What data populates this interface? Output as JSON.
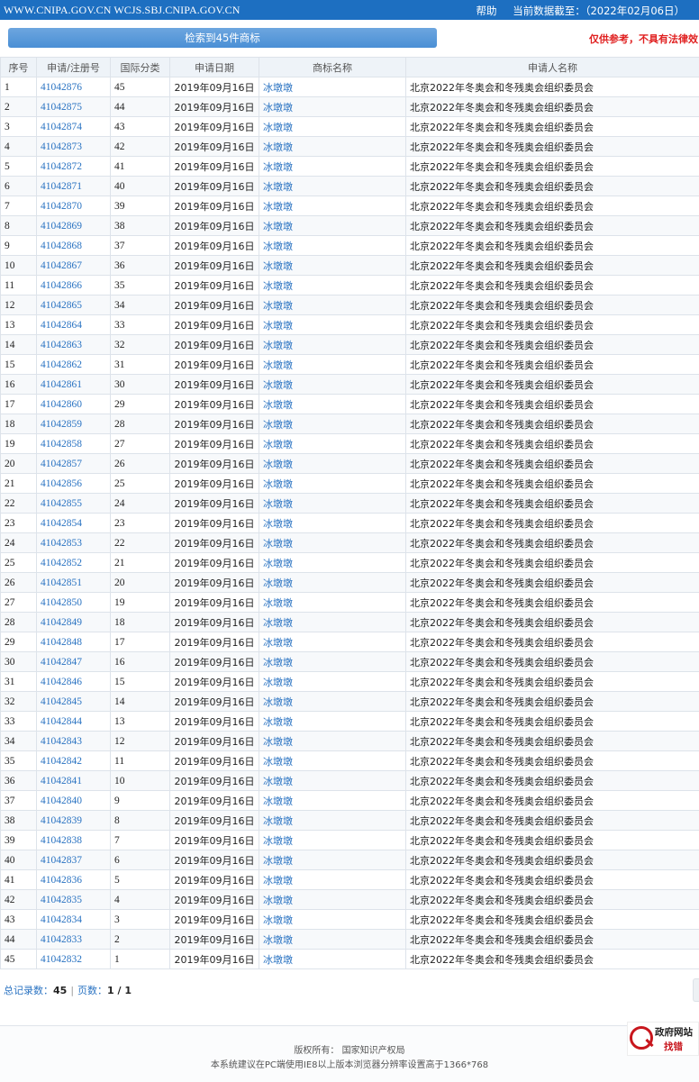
{
  "topbar": {
    "site": "WWW.CNIPA.GOV.CN WCJS.SBJ.CNIPA.GOV.CN",
    "help": "帮助",
    "data_as_of": "当前数据截至：（2022年02月06日）"
  },
  "search": {
    "result_label": "检索到45件商标",
    "disclaimer": "仅供参考，不具有法律效"
  },
  "table": {
    "headers": [
      "序号",
      "申请/注册号",
      "国际分类",
      "申请日期",
      "商标名称",
      "申请人名称"
    ],
    "rows": [
      {
        "no": "1",
        "reg": "41042876",
        "cls": "45",
        "date": "2019年09月16日",
        "mark": "冰墩墩",
        "applicant": "北京2022年冬奥会和冬残奥会组织委员会"
      },
      {
        "no": "2",
        "reg": "41042875",
        "cls": "44",
        "date": "2019年09月16日",
        "mark": "冰墩墩",
        "applicant": "北京2022年冬奥会和冬残奥会组织委员会"
      },
      {
        "no": "3",
        "reg": "41042874",
        "cls": "43",
        "date": "2019年09月16日",
        "mark": "冰墩墩",
        "applicant": "北京2022年冬奥会和冬残奥会组织委员会"
      },
      {
        "no": "4",
        "reg": "41042873",
        "cls": "42",
        "date": "2019年09月16日",
        "mark": "冰墩墩",
        "applicant": "北京2022年冬奥会和冬残奥会组织委员会"
      },
      {
        "no": "5",
        "reg": "41042872",
        "cls": "41",
        "date": "2019年09月16日",
        "mark": "冰墩墩",
        "applicant": "北京2022年冬奥会和冬残奥会组织委员会"
      },
      {
        "no": "6",
        "reg": "41042871",
        "cls": "40",
        "date": "2019年09月16日",
        "mark": "冰墩墩",
        "applicant": "北京2022年冬奥会和冬残奥会组织委员会"
      },
      {
        "no": "7",
        "reg": "41042870",
        "cls": "39",
        "date": "2019年09月16日",
        "mark": "冰墩墩",
        "applicant": "北京2022年冬奥会和冬残奥会组织委员会"
      },
      {
        "no": "8",
        "reg": "41042869",
        "cls": "38",
        "date": "2019年09月16日",
        "mark": "冰墩墩",
        "applicant": "北京2022年冬奥会和冬残奥会组织委员会"
      },
      {
        "no": "9",
        "reg": "41042868",
        "cls": "37",
        "date": "2019年09月16日",
        "mark": "冰墩墩",
        "applicant": "北京2022年冬奥会和冬残奥会组织委员会"
      },
      {
        "no": "10",
        "reg": "41042867",
        "cls": "36",
        "date": "2019年09月16日",
        "mark": "冰墩墩",
        "applicant": "北京2022年冬奥会和冬残奥会组织委员会"
      },
      {
        "no": "11",
        "reg": "41042866",
        "cls": "35",
        "date": "2019年09月16日",
        "mark": "冰墩墩",
        "applicant": "北京2022年冬奥会和冬残奥会组织委员会"
      },
      {
        "no": "12",
        "reg": "41042865",
        "cls": "34",
        "date": "2019年09月16日",
        "mark": "冰墩墩",
        "applicant": "北京2022年冬奥会和冬残奥会组织委员会"
      },
      {
        "no": "13",
        "reg": "41042864",
        "cls": "33",
        "date": "2019年09月16日",
        "mark": "冰墩墩",
        "applicant": "北京2022年冬奥会和冬残奥会组织委员会"
      },
      {
        "no": "14",
        "reg": "41042863",
        "cls": "32",
        "date": "2019年09月16日",
        "mark": "冰墩墩",
        "applicant": "北京2022年冬奥会和冬残奥会组织委员会"
      },
      {
        "no": "15",
        "reg": "41042862",
        "cls": "31",
        "date": "2019年09月16日",
        "mark": "冰墩墩",
        "applicant": "北京2022年冬奥会和冬残奥会组织委员会"
      },
      {
        "no": "16",
        "reg": "41042861",
        "cls": "30",
        "date": "2019年09月16日",
        "mark": "冰墩墩",
        "applicant": "北京2022年冬奥会和冬残奥会组织委员会"
      },
      {
        "no": "17",
        "reg": "41042860",
        "cls": "29",
        "date": "2019年09月16日",
        "mark": "冰墩墩",
        "applicant": "北京2022年冬奥会和冬残奥会组织委员会"
      },
      {
        "no": "18",
        "reg": "41042859",
        "cls": "28",
        "date": "2019年09月16日",
        "mark": "冰墩墩",
        "applicant": "北京2022年冬奥会和冬残奥会组织委员会"
      },
      {
        "no": "19",
        "reg": "41042858",
        "cls": "27",
        "date": "2019年09月16日",
        "mark": "冰墩墩",
        "applicant": "北京2022年冬奥会和冬残奥会组织委员会"
      },
      {
        "no": "20",
        "reg": "41042857",
        "cls": "26",
        "date": "2019年09月16日",
        "mark": "冰墩墩",
        "applicant": "北京2022年冬奥会和冬残奥会组织委员会"
      },
      {
        "no": "21",
        "reg": "41042856",
        "cls": "25",
        "date": "2019年09月16日",
        "mark": "冰墩墩",
        "applicant": "北京2022年冬奥会和冬残奥会组织委员会"
      },
      {
        "no": "22",
        "reg": "41042855",
        "cls": "24",
        "date": "2019年09月16日",
        "mark": "冰墩墩",
        "applicant": "北京2022年冬奥会和冬残奥会组织委员会"
      },
      {
        "no": "23",
        "reg": "41042854",
        "cls": "23",
        "date": "2019年09月16日",
        "mark": "冰墩墩",
        "applicant": "北京2022年冬奥会和冬残奥会组织委员会"
      },
      {
        "no": "24",
        "reg": "41042853",
        "cls": "22",
        "date": "2019年09月16日",
        "mark": "冰墩墩",
        "applicant": "北京2022年冬奥会和冬残奥会组织委员会"
      },
      {
        "no": "25",
        "reg": "41042852",
        "cls": "21",
        "date": "2019年09月16日",
        "mark": "冰墩墩",
        "applicant": "北京2022年冬奥会和冬残奥会组织委员会"
      },
      {
        "no": "26",
        "reg": "41042851",
        "cls": "20",
        "date": "2019年09月16日",
        "mark": "冰墩墩",
        "applicant": "北京2022年冬奥会和冬残奥会组织委员会"
      },
      {
        "no": "27",
        "reg": "41042850",
        "cls": "19",
        "date": "2019年09月16日",
        "mark": "冰墩墩",
        "applicant": "北京2022年冬奥会和冬残奥会组织委员会"
      },
      {
        "no": "28",
        "reg": "41042849",
        "cls": "18",
        "date": "2019年09月16日",
        "mark": "冰墩墩",
        "applicant": "北京2022年冬奥会和冬残奥会组织委员会"
      },
      {
        "no": "29",
        "reg": "41042848",
        "cls": "17",
        "date": "2019年09月16日",
        "mark": "冰墩墩",
        "applicant": "北京2022年冬奥会和冬残奥会组织委员会"
      },
      {
        "no": "30",
        "reg": "41042847",
        "cls": "16",
        "date": "2019年09月16日",
        "mark": "冰墩墩",
        "applicant": "北京2022年冬奥会和冬残奥会组织委员会"
      },
      {
        "no": "31",
        "reg": "41042846",
        "cls": "15",
        "date": "2019年09月16日",
        "mark": "冰墩墩",
        "applicant": "北京2022年冬奥会和冬残奥会组织委员会"
      },
      {
        "no": "32",
        "reg": "41042845",
        "cls": "14",
        "date": "2019年09月16日",
        "mark": "冰墩墩",
        "applicant": "北京2022年冬奥会和冬残奥会组织委员会"
      },
      {
        "no": "33",
        "reg": "41042844",
        "cls": "13",
        "date": "2019年09月16日",
        "mark": "冰墩墩",
        "applicant": "北京2022年冬奥会和冬残奥会组织委员会"
      },
      {
        "no": "34",
        "reg": "41042843",
        "cls": "12",
        "date": "2019年09月16日",
        "mark": "冰墩墩",
        "applicant": "北京2022年冬奥会和冬残奥会组织委员会"
      },
      {
        "no": "35",
        "reg": "41042842",
        "cls": "11",
        "date": "2019年09月16日",
        "mark": "冰墩墩",
        "applicant": "北京2022年冬奥会和冬残奥会组织委员会"
      },
      {
        "no": "36",
        "reg": "41042841",
        "cls": "10",
        "date": "2019年09月16日",
        "mark": "冰墩墩",
        "applicant": "北京2022年冬奥会和冬残奥会组织委员会"
      },
      {
        "no": "37",
        "reg": "41042840",
        "cls": "9",
        "date": "2019年09月16日",
        "mark": "冰墩墩",
        "applicant": "北京2022年冬奥会和冬残奥会组织委员会"
      },
      {
        "no": "38",
        "reg": "41042839",
        "cls": "8",
        "date": "2019年09月16日",
        "mark": "冰墩墩",
        "applicant": "北京2022年冬奥会和冬残奥会组织委员会"
      },
      {
        "no": "39",
        "reg": "41042838",
        "cls": "7",
        "date": "2019年09月16日",
        "mark": "冰墩墩",
        "applicant": "北京2022年冬奥会和冬残奥会组织委员会"
      },
      {
        "no": "40",
        "reg": "41042837",
        "cls": "6",
        "date": "2019年09月16日",
        "mark": "冰墩墩",
        "applicant": "北京2022年冬奥会和冬残奥会组织委员会"
      },
      {
        "no": "41",
        "reg": "41042836",
        "cls": "5",
        "date": "2019年09月16日",
        "mark": "冰墩墩",
        "applicant": "北京2022年冬奥会和冬残奥会组织委员会"
      },
      {
        "no": "42",
        "reg": "41042835",
        "cls": "4",
        "date": "2019年09月16日",
        "mark": "冰墩墩",
        "applicant": "北京2022年冬奥会和冬残奥会组织委员会"
      },
      {
        "no": "43",
        "reg": "41042834",
        "cls": "3",
        "date": "2019年09月16日",
        "mark": "冰墩墩",
        "applicant": "北京2022年冬奥会和冬残奥会组织委员会"
      },
      {
        "no": "44",
        "reg": "41042833",
        "cls": "2",
        "date": "2019年09月16日",
        "mark": "冰墩墩",
        "applicant": "北京2022年冬奥会和冬残奥会组织委员会"
      },
      {
        "no": "45",
        "reg": "41042832",
        "cls": "1",
        "date": "2019年09月16日",
        "mark": "冰墩墩",
        "applicant": "北京2022年冬奥会和冬残奥会组织委员会"
      }
    ]
  },
  "summary": {
    "total_label": "总记录数：",
    "total": "45",
    "separator": "|",
    "pages_label": "页数：",
    "pages": "1 / 1"
  },
  "footer": {
    "copyright": "版权所有：  国家知识产权局",
    "browser_hint": "本系统建议在PC端使用IE8以上版本浏览器分辨率设置高于1366*768",
    "gov_badge_title": "政府网站",
    "gov_badge_action": "找错"
  },
  "colors": {
    "topbar_bg": "#1d6fc1",
    "link": "#2a73c2",
    "disclaimer": "#e02020",
    "badge_red": "#c8161d"
  }
}
